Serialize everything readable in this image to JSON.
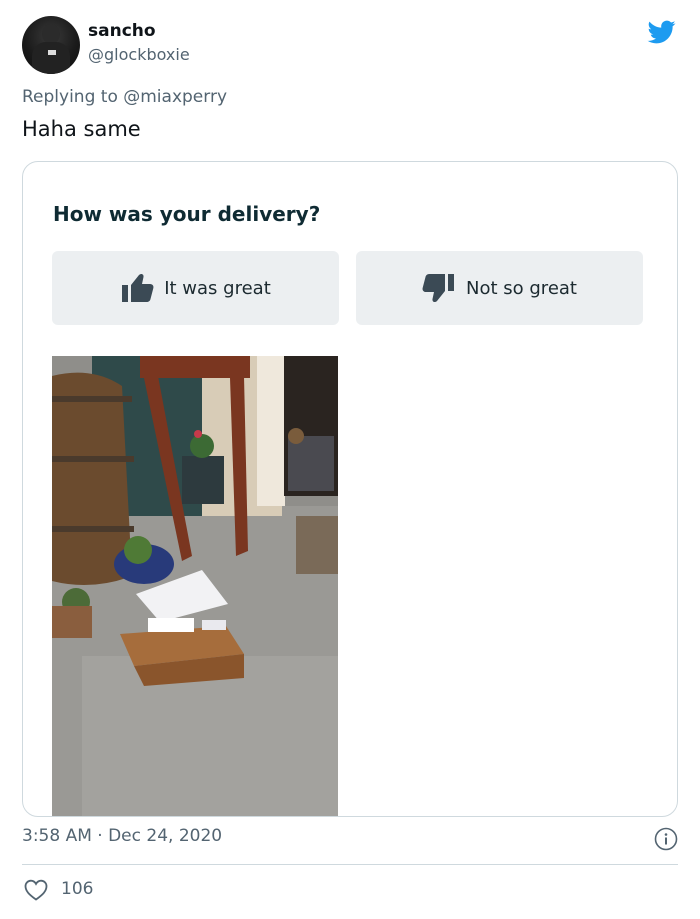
{
  "tweet": {
    "author_name": "sancho",
    "author_handle": "@glockboxie",
    "reply_prefix": "Replying to",
    "reply_to": "@miaxperry",
    "text": "Haha same",
    "timestamp": "3:58 AM · Dec 24, 2020",
    "likes": "106",
    "icons": [
      "twitter-bird-icon",
      "info-icon",
      "heart-icon"
    ]
  },
  "card": {
    "question": "How was your delivery?",
    "positive_label": "It was great",
    "negative_label": "Not so great",
    "icons": [
      "thumbs-up-icon",
      "thumbs-down-icon"
    ]
  },
  "colors": {
    "twitter_blue": "#1d9bf0",
    "secondary_text": "#536471",
    "button_bg": "#eceff1",
    "question_text": "#0f2b33"
  }
}
